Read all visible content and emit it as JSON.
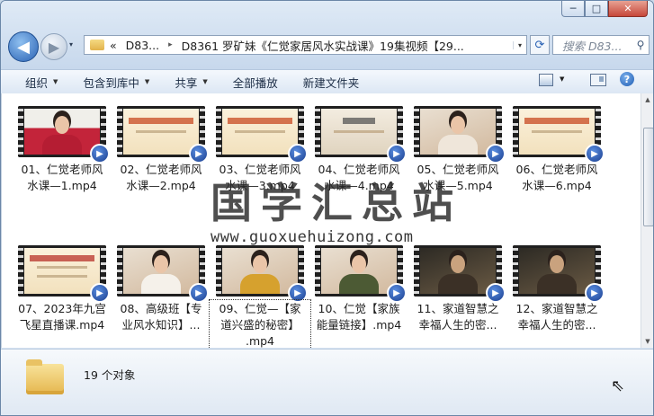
{
  "window": {
    "minimize": "─",
    "maximize": "□",
    "close": "✕"
  },
  "nav": {
    "back": "◀",
    "forward": "▶",
    "history": "▾"
  },
  "address": {
    "chevron": "«",
    "root": "D83...",
    "separator": "▸",
    "path": "D8361 罗矿妹《仁觉家居风水实战课》19集视频【29...",
    "dropdown": "▾"
  },
  "search": {
    "placeholder": "搜索 D83..."
  },
  "toolbar": {
    "organize": "组织",
    "include_library": "包含到库中",
    "share": "共享",
    "play_all": "全部播放",
    "new_folder": "新建文件夹"
  },
  "files": [
    {
      "line1": "01、仁觉老师风",
      "line2": "水课—1.mp4",
      "line3": ""
    },
    {
      "line1": "02、仁觉老师风",
      "line2": "水课—2.mp4",
      "line3": ""
    },
    {
      "line1": "03、仁觉老师风",
      "line2": "水课—3.mp4",
      "line3": ""
    },
    {
      "line1": "04、仁觉老师风",
      "line2": "水课—4.mp4",
      "line3": ""
    },
    {
      "line1": "05、仁觉老师风",
      "line2": "水课—5.mp4",
      "line3": ""
    },
    {
      "line1": "06、仁觉老师风",
      "line2": "水课—6.mp4",
      "line3": ""
    },
    {
      "line1": "07、2023年九宫",
      "line2": "飞星直播课.mp4",
      "line3": ""
    },
    {
      "line1": "08、高级班【专",
      "line2": "业风水知识】...",
      "line3": ""
    },
    {
      "line1": "09、仁觉—【家",
      "line2": "道兴盛的秘密】",
      "line3": ".mp4"
    },
    {
      "line1": "10、仁觉【家族",
      "line2": "能量链接】.mp4",
      "line3": ""
    },
    {
      "line1": "11、家道智慧之",
      "line2": "幸福人生的密...",
      "line3": ""
    },
    {
      "line1": "12、家道智慧之",
      "line2": "幸福人生的密...",
      "line3": ""
    }
  ],
  "watermark": {
    "text": "国学汇总站",
    "url": "www.guoxuehuizong.com"
  },
  "details": {
    "count": "19 个对象"
  },
  "colors": {
    "selection_badge": "#1a3e8f",
    "window_frame": "#6b87a8",
    "close_button": "#c6473a"
  }
}
